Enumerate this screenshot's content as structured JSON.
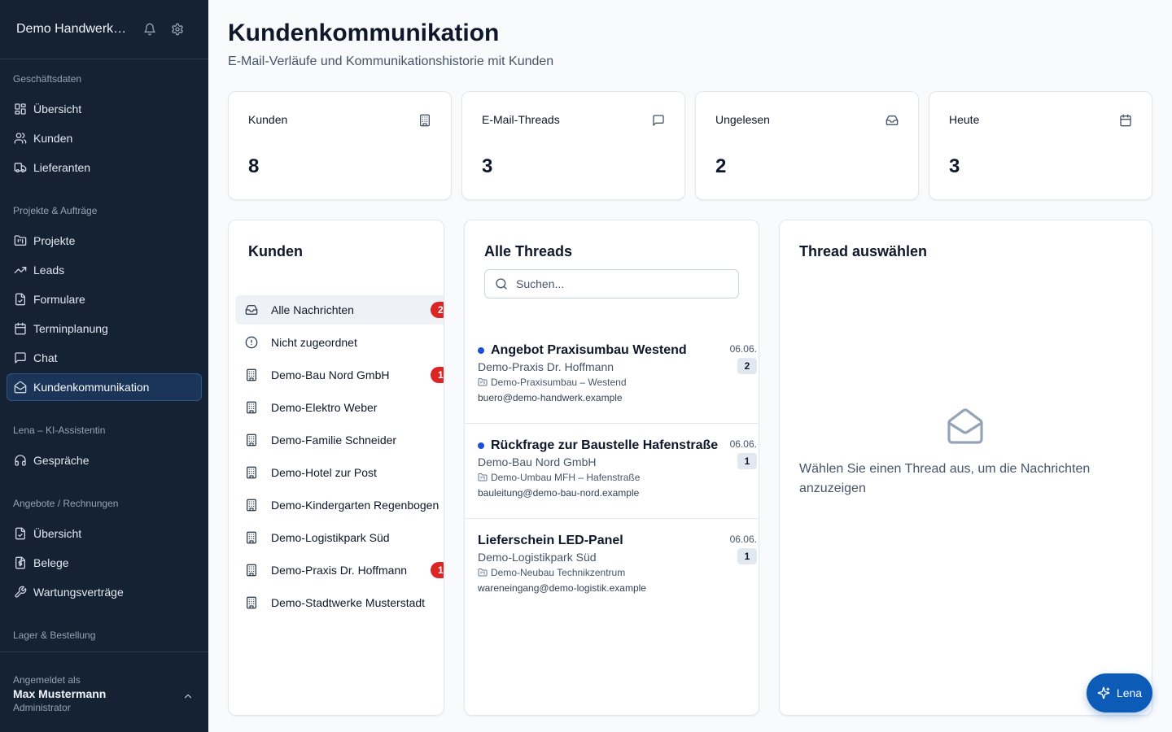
{
  "sidebar": {
    "title": "Demo Handwerk GmbH",
    "groups": [
      {
        "label": "Geschäftsdaten",
        "items": [
          {
            "label": "Übersicht",
            "icon": "dashboard-icon"
          },
          {
            "label": "Kunden",
            "icon": "users-icon"
          },
          {
            "label": "Lieferanten",
            "icon": "truck-icon"
          }
        ]
      },
      {
        "label": "Projekte & Aufträge",
        "items": [
          {
            "label": "Projekte",
            "icon": "folder-kanban-icon"
          },
          {
            "label": "Leads",
            "icon": "trending-up-icon"
          },
          {
            "label": "Formulare",
            "icon": "file-check-icon"
          },
          {
            "label": "Terminplanung",
            "icon": "calendar-icon"
          },
          {
            "label": "Chat",
            "icon": "message-square-icon"
          },
          {
            "label": "Kundenkommunikation",
            "icon": "mail-open-icon",
            "active": true
          }
        ]
      },
      {
        "label": "Lena – KI-Assistentin",
        "items": [
          {
            "label": "Gespräche",
            "icon": "headphones-icon"
          }
        ]
      },
      {
        "label": "Angebote / Rechnungen",
        "items": [
          {
            "label": "Übersicht",
            "icon": "file-check-icon"
          },
          {
            "label": "Belege",
            "icon": "receipt-file-icon"
          },
          {
            "label": "Wartungsverträge",
            "icon": "wrench-icon"
          }
        ]
      },
      {
        "label": "Lager & Bestellung",
        "items": []
      }
    ],
    "footer": {
      "logged_in_label": "Angemeldet als",
      "user_name": "Max Mustermann",
      "role": "Administrator"
    }
  },
  "header": {
    "title": "Kundenkommunikation",
    "subtitle": "E-Mail-Verläufe und Kommunikationshistorie mit Kunden"
  },
  "stats": [
    {
      "label": "Kunden",
      "value": "8",
      "icon": "building-icon"
    },
    {
      "label": "E-Mail-Threads",
      "value": "3",
      "icon": "message-square-icon"
    },
    {
      "label": "Ungelesen",
      "value": "2",
      "icon": "inbox-icon"
    },
    {
      "label": "Heute",
      "value": "3",
      "icon": "calendar-icon"
    }
  ],
  "customers": {
    "title": "Kunden",
    "items": [
      {
        "label": "Alle Nachrichten",
        "icon": "inbox-icon",
        "badge": "2",
        "active": true
      },
      {
        "label": "Nicht zugeordnet",
        "icon": "alert-circle-icon",
        "badge": ""
      },
      {
        "label": "Demo-Bau Nord GmbH",
        "icon": "building-icon",
        "badge": "1"
      },
      {
        "label": "Demo-Elektro Weber",
        "icon": "building-icon",
        "badge": ""
      },
      {
        "label": "Demo-Familie Schneider",
        "icon": "building-icon",
        "badge": ""
      },
      {
        "label": "Demo-Hotel zur Post",
        "icon": "building-icon",
        "badge": ""
      },
      {
        "label": "Demo-Kindergarten Regenbogen",
        "icon": "building-icon",
        "badge": ""
      },
      {
        "label": "Demo-Logistikpark Süd",
        "icon": "building-icon",
        "badge": ""
      },
      {
        "label": "Demo-Praxis Dr. Hoffmann",
        "icon": "building-icon",
        "badge": "1"
      },
      {
        "label": "Demo-Stadtwerke Musterstadt",
        "icon": "building-icon",
        "badge": ""
      }
    ]
  },
  "threads": {
    "title": "Alle Threads",
    "search_placeholder": "Suchen...",
    "items": [
      {
        "subject": "Angebot Praxisumbau Westend",
        "unread": true,
        "customer": "Demo-Praxis Dr. Hoffmann",
        "project": "Demo-Praxisumbau – Westend",
        "email": "buero@demo-handwerk.example",
        "date": "06.06.",
        "count": "2"
      },
      {
        "subject": "Rückfrage zur Baustelle Hafenstraße",
        "unread": true,
        "customer": "Demo-Bau Nord GmbH",
        "project": "Demo-Umbau MFH – Hafenstraße",
        "email": "bauleitung@demo-bau-nord.example",
        "date": "06.06.",
        "count": "1"
      },
      {
        "subject": "Lieferschein LED-Panel",
        "unread": false,
        "customer": "Demo-Logistikpark Süd",
        "project": "Demo-Neubau Technikzentrum",
        "email": "wareneingang@demo-logistik.example",
        "date": "06.06.",
        "count": "1"
      }
    ]
  },
  "detail": {
    "title": "Thread auswählen",
    "empty_text": "Wählen Sie einen Thread aus, um die Nachrichten anzuzeigen",
    "icon": "mail-open-icon"
  },
  "assistant_button": {
    "label": "Lena",
    "icon": "sparkles-icon",
    "color": "#0b5bb7"
  },
  "colors": {
    "sidebar_bg": "#152234",
    "active_bg": "#1b3558",
    "badge_red": "#dc2626",
    "unread_dot": "#1d4ed8"
  }
}
